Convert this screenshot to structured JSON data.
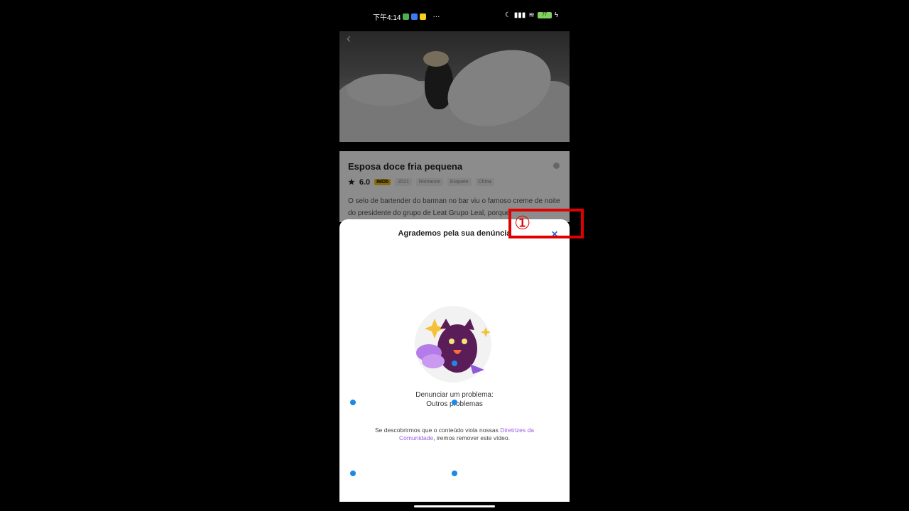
{
  "status_bar": {
    "time": "下午4:14",
    "more": "···",
    "battery": "77"
  },
  "movie": {
    "title": "Esposa doce fria pequena",
    "rating": "6.0",
    "imdb": "IMDb",
    "year": "2021",
    "tags": [
      "Romance",
      "Esquete",
      "China"
    ],
    "description": "O selo de bartender do barman no bar viu o famoso creme de noite do presidente do grupo de Leat Grupo Leal, porque"
  },
  "sheet": {
    "title": "Agrademos pela sua denúncia",
    "close": "✕",
    "report_line1": "Denunciar um problema:",
    "report_line2": "Outros problemas",
    "policy_pre": "Se descobrirmos que o conteúdo viola nossas ",
    "policy_link": "Diretrizes da Comunidade",
    "policy_post": ", iremos remover este vídeo."
  },
  "annotation": {
    "label": "①"
  },
  "colors": {
    "accent_link": "#9a5ce0",
    "annotation": "#e00000",
    "close": "#1e63d6"
  }
}
